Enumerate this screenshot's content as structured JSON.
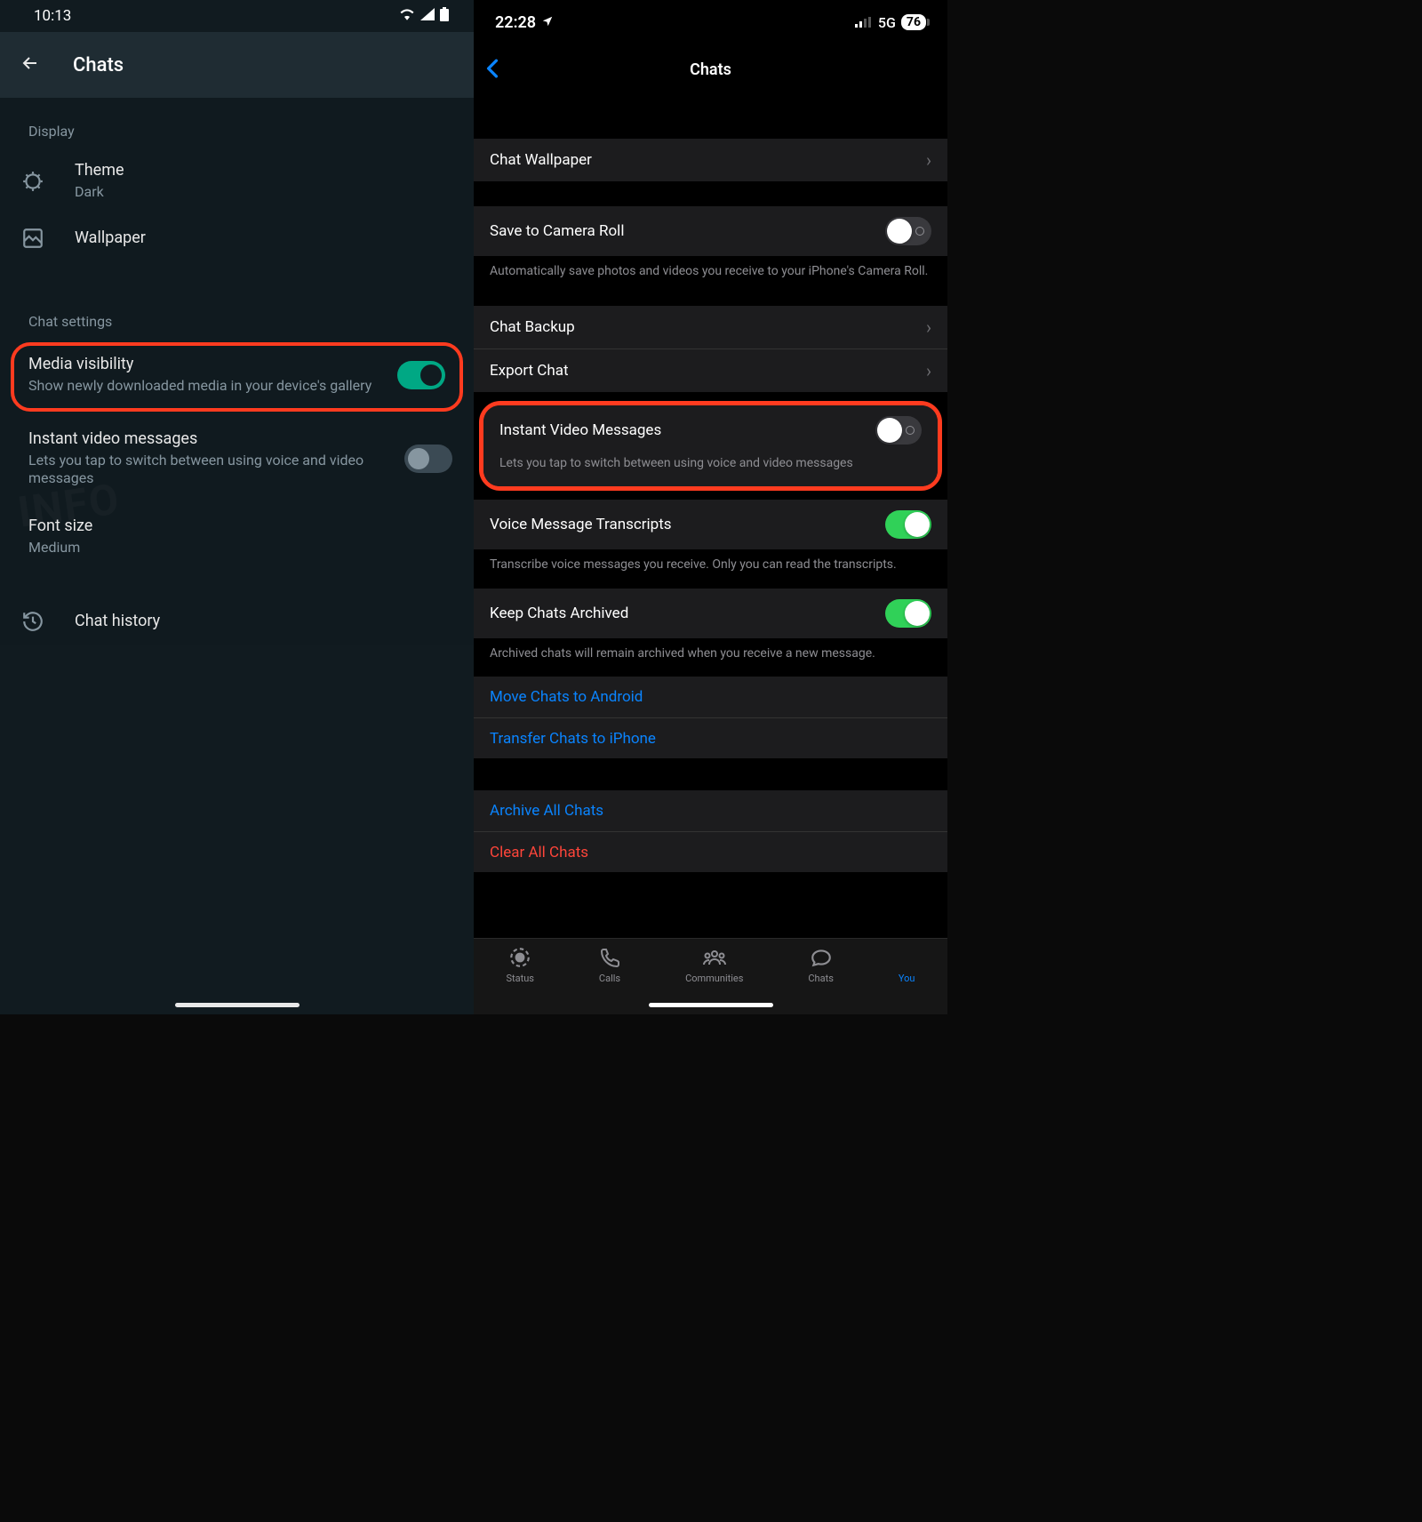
{
  "android": {
    "statusTime": "10:13",
    "headerTitle": "Chats",
    "sectionDisplay": "Display",
    "theme": {
      "label": "Theme",
      "value": "Dark"
    },
    "wallpaper": {
      "label": "Wallpaper"
    },
    "sectionChatSettings": "Chat settings",
    "mediaVisibility": {
      "label": "Media visibility",
      "desc": "Show newly downloaded media in your device's gallery"
    },
    "instantVideo": {
      "label": "Instant video messages",
      "desc": "Lets you tap to switch between using voice and video messages"
    },
    "fontSize": {
      "label": "Font size",
      "value": "Medium"
    },
    "chatHistory": {
      "label": "Chat history"
    }
  },
  "ios": {
    "statusTime": "22:28",
    "network": "5G",
    "battery": "76",
    "headerTitle": "Chats",
    "chatWallpaper": "Chat Wallpaper",
    "saveCameraRoll": "Save to Camera Roll",
    "saveCameraRollDesc": "Automatically save photos and videos you receive to your iPhone's Camera Roll.",
    "chatBackup": "Chat Backup",
    "exportChat": "Export Chat",
    "instantVideo": "Instant Video Messages",
    "instantVideoDesc": "Lets you tap to switch between using voice and video messages",
    "voiceTranscripts": "Voice Message Transcripts",
    "voiceTranscriptsDesc": "Transcribe voice messages you receive. Only you can read the transcripts.",
    "keepArchived": "Keep Chats Archived",
    "keepArchivedDesc": "Archived chats will remain archived when you receive a new message.",
    "moveAndroid": "Move Chats to Android",
    "transferIphone": "Transfer Chats to iPhone",
    "archiveAll": "Archive All Chats",
    "clearAll": "Clear All Chats",
    "tabs": {
      "status": "Status",
      "calls": "Calls",
      "communities": "Communities",
      "chats": "Chats",
      "you": "You"
    }
  },
  "watermark": "INFO"
}
